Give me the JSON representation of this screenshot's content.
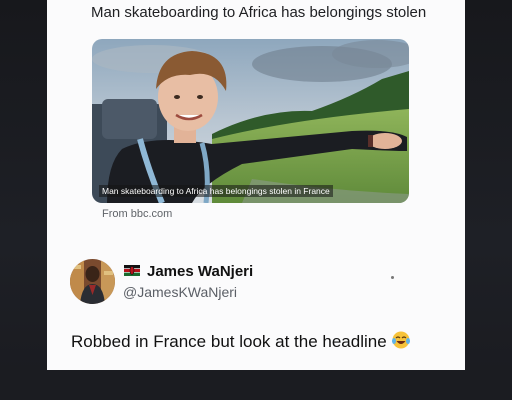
{
  "article": {
    "headline": "Man skateboarding to Africa has belongings stolen",
    "image_caption": "Man skateboarding to Africa has belongings stolen in France",
    "source": "From bbc.com"
  },
  "post": {
    "display_name": "James WaNjeri",
    "handle": "@JamesKWaNjeri",
    "flag": "kenya-flag-icon",
    "text": "Robbed in France but look at the headline",
    "emoji": "face-with-tears-of-joy-icon"
  },
  "colors": {
    "card_bg": "#fbfbfc",
    "page_bg": "#121317",
    "text_primary": "#111111",
    "text_secondary": "#5b5f66"
  }
}
